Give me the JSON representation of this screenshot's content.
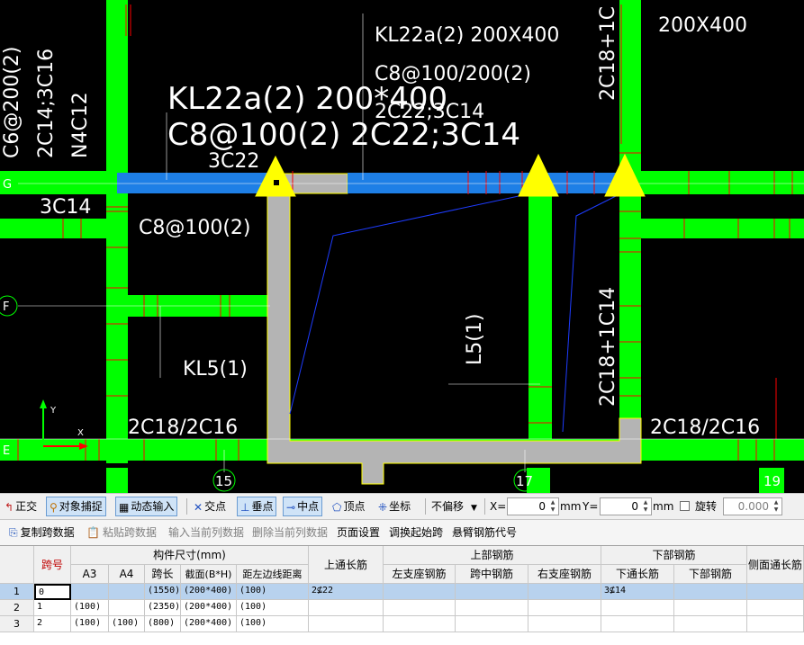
{
  "cad": {
    "axis_labels": {
      "g": "G",
      "f": "F",
      "e": "E",
      "c15": "15",
      "c17": "17",
      "c19": "19"
    },
    "ucs": {
      "y": "Y",
      "x": "X"
    },
    "annotations": {
      "t1": "KL22a(2) 200X400",
      "t2": "C8@100/200(2)",
      "t3": "2C22;3C14",
      "t4": "KL22a(2) 200*400",
      "t5": "C8@100(2) 2C22;3C14",
      "t6": "3C22",
      "t7": "3C14",
      "t8": "C8@100(2)",
      "t9": "KL5(1)",
      "t10": "2C18/2C16",
      "t11": "2C18/2C16",
      "t12": "L5(1)",
      "t13": "2C18+1C14",
      "t14": "2C18+1C",
      "t15": "200X400",
      "t16": "C6@200(2)",
      "t17": "2C14;3C16",
      "t18": "N4C12"
    }
  },
  "snapbar": {
    "ortho": "正交",
    "object_snap": "对象捕捉",
    "dynamic_input": "动态输入",
    "intersection": "交点",
    "perpendicular": "垂点",
    "midpoint": "中点",
    "vertex": "顶点",
    "coordinate": "坐标",
    "offset_select": "不偏移",
    "x_label": "X=",
    "x_value": "0",
    "y_label": "Y=",
    "y_value": "0",
    "unit1": "mm",
    "unit2": "mm",
    "rotate": "旋转",
    "rotate_value": "0.000"
  },
  "gridbar": {
    "copy": "复制跨数据",
    "paste": "粘贴跨数据",
    "input_col": "输入当前列数据",
    "delete_col": "删除当前列数据",
    "page_setup": "页面设置",
    "swap_span": "调换起始跨",
    "cantilever": "悬臂钢筋代号"
  },
  "table": {
    "headers": {
      "span_no": "跨号",
      "size_group": "构件尺寸(mm)",
      "a3": "A3",
      "a4": "A4",
      "span_len": "跨长",
      "section": "截面(B*H)",
      "edge_dist": "距左边线距离",
      "top_long": "上通长筋",
      "top_group": "上部钢筋",
      "left_sup": "左支座钢筋",
      "mid_span": "跨中钢筋",
      "right_sup": "右支座钢筋",
      "bottom_group": "下部钢筋",
      "bottom_long": "下通长筋",
      "bottom_bar": "下部钢筋",
      "side_long": "侧面通长筋"
    },
    "rows": [
      {
        "rn": "1",
        "span": "0",
        "a3": "",
        "a4": "",
        "len": "(1550)",
        "sec": "(200*400)",
        "dist": "(100)",
        "top_long": "2⊈22",
        "left": "",
        "mid": "",
        "right": "",
        "bot_long": "3⊈14",
        "bot": "",
        "side": ""
      },
      {
        "rn": "2",
        "span": "1",
        "a3": "(100)",
        "a4": "",
        "len": "(2350)",
        "sec": "(200*400)",
        "dist": "(100)",
        "top_long": "",
        "left": "",
        "mid": "",
        "right": "",
        "bot_long": "",
        "bot": "",
        "side": ""
      },
      {
        "rn": "3",
        "span": "2",
        "a3": "(100)",
        "a4": "(100)",
        "len": "(800)",
        "sec": "(200*400)",
        "dist": "(100)",
        "top_long": "",
        "left": "",
        "mid": "",
        "right": "",
        "bot_long": "",
        "bot": "",
        "side": ""
      }
    ]
  },
  "colors": {
    "beam_green": "#00ff00",
    "selected_beam": "#1e7fe6",
    "slab_gray": "#b4b4b4",
    "support_yellow": "#ffff00",
    "red_mark": "#ff0000",
    "annotation_white": "#ffffff"
  }
}
